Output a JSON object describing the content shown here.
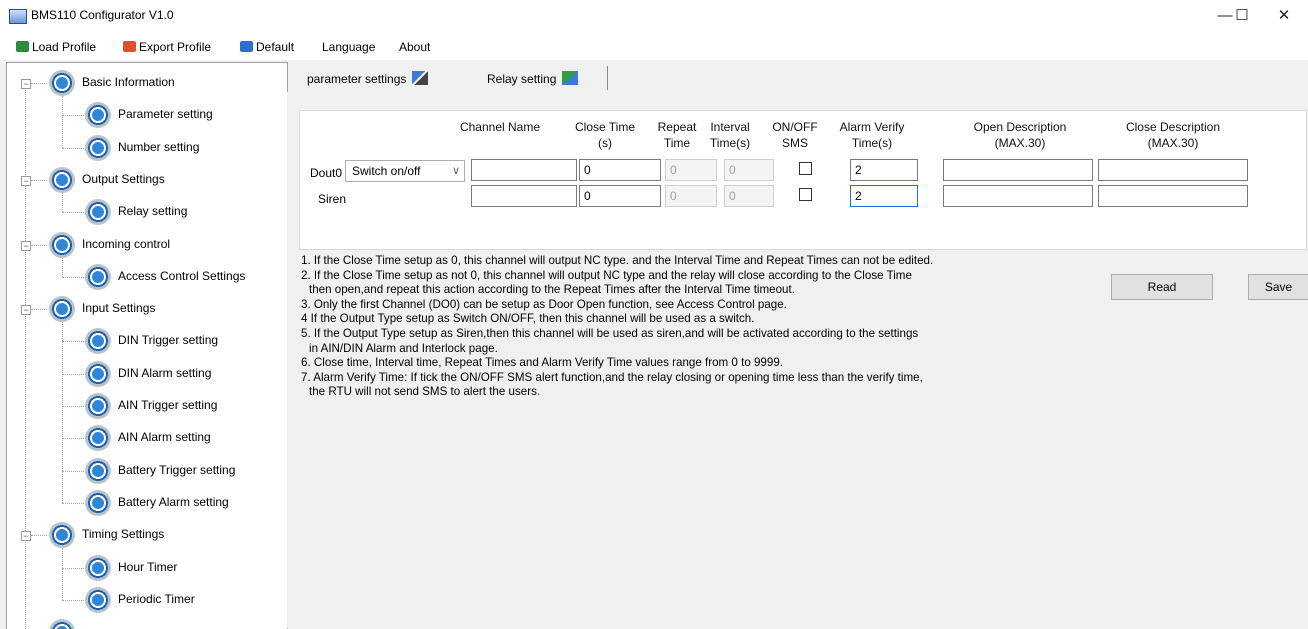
{
  "window": {
    "title": "BMS110 Configurator V1.0",
    "minimize_glyph": "—",
    "maximize_glyph": "☐",
    "close_glyph": "✕"
  },
  "menu": {
    "load": "Load Profile",
    "export": "Export Profile",
    "default": "Default",
    "language": "Language",
    "about": "About"
  },
  "tree": {
    "collapse_glyph": "−",
    "groups": [
      {
        "label": "Basic Information",
        "children": [
          "Parameter setting",
          "Number setting"
        ]
      },
      {
        "label": "Output Settings",
        "children": [
          "Relay setting"
        ]
      },
      {
        "label": "Incoming control",
        "children": [
          "Access Control Settings"
        ]
      },
      {
        "label": "Input Settings",
        "children": [
          "DIN Trigger setting",
          "DIN Alarm setting",
          "AIN Trigger setting",
          "AIN Alarm setting",
          "Battery Trigger setting",
          "Battery Alarm setting"
        ]
      },
      {
        "label": "Timing Settings",
        "children": [
          "Hour Timer",
          "Periodic Timer"
        ]
      }
    ]
  },
  "tabs": {
    "parameter": "parameter settings",
    "relay": "Relay setting"
  },
  "relay": {
    "headers": {
      "channel_name": "Channel Name",
      "close_time_1": "Close Time",
      "close_time_2": "(s)",
      "repeat_1": "Repeat",
      "repeat_2": "Time",
      "interval_1": "Interval",
      "interval_2": "Time(s)",
      "onoff_1": "ON/OFF",
      "onoff_2": "SMS",
      "verify_1": "Alarm Verify",
      "verify_2": "Time(s)",
      "open_1": "Open Description",
      "open_2": "(MAX.30)",
      "close_1": "Close Description",
      "close_2": "(MAX.30)"
    },
    "rows": [
      {
        "label": "Dout0",
        "type": "Switch on/off",
        "channel_name": "",
        "close_time": "0",
        "repeat": "0",
        "interval": "0",
        "sms_checked": false,
        "verify": "2",
        "open_desc": "",
        "close_desc": ""
      },
      {
        "label": "Siren",
        "channel_name": "",
        "close_time": "0",
        "repeat": "0",
        "interval": "0",
        "sms_checked": false,
        "verify": "2",
        "open_desc": "",
        "close_desc": ""
      }
    ],
    "combo_arrow": "∨"
  },
  "notes": [
    "1. If the Close Time setup as 0, this channel will output NC type. and the Interval Time and Repeat Times can not be edited.",
    "2. If the Close Time setup as not 0, this channel will output NC type and the relay will close according to the Close Time",
    "   then open,and repeat this action according to the Repeat Times after the Interval Time timeout.",
    "3. Only the first Channel (DO0) can be setup as Door Open function, see Access Control page.",
    "4  If the Output Type setup as Switch ON/OFF, then this channel will be used as a switch.",
    "5. If the Output Type setup as Siren,then this channel will be used as siren,and will be activated according to the settings",
    "   in AIN/DIN Alarm and Interlock page.",
    "6. Close time, Interval time, Repeat Times and Alarm Verify Time values range from 0 to 9999.",
    "7. Alarm Verify Time: If tick the ON/OFF SMS alert function,and the relay closing or opening time less than the verify time,",
    "   the RTU will not send SMS to alert the users."
  ],
  "buttons": {
    "read": "Read",
    "save": "Save"
  }
}
